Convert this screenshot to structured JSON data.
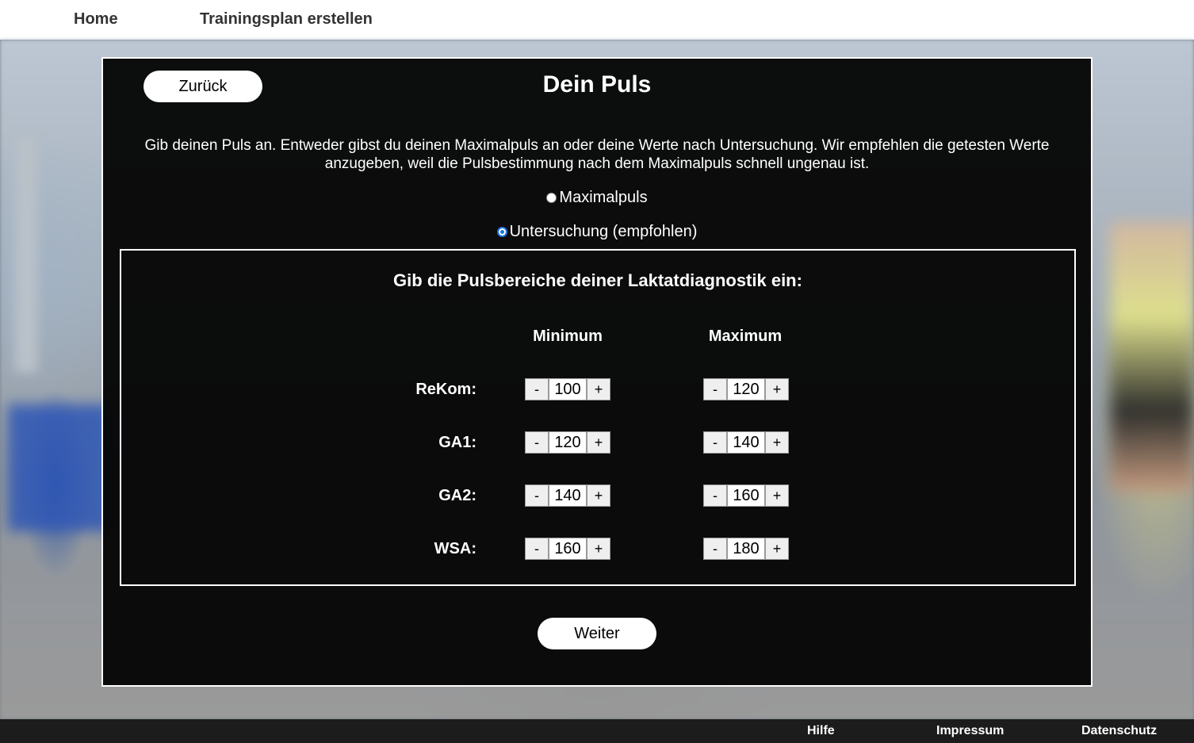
{
  "nav": {
    "home": "Home",
    "create_plan": "Trainingsplan erstellen"
  },
  "panel": {
    "back_label": "Zurück",
    "title": "Dein Puls",
    "intro": "Gib deinen Puls an. Entweder gibst du deinen Maximalpuls an oder deine Werte nach Untersuchung. Wir empfehlen die getesten Werte anzugeben, weil die Pulsbestimmung nach dem Maximalpuls schnell ungenau ist.",
    "options": [
      {
        "label": "Maximalpuls",
        "checked": false
      },
      {
        "label": "Untersuchung (empfohlen)",
        "checked": true
      }
    ],
    "next_label": "Weiter"
  },
  "zones": {
    "title": "Gib die Pulsbereiche deiner Laktatdiagnostik ein:",
    "col_min": "Minimum",
    "col_max": "Maximum",
    "minus": "-",
    "plus": "+",
    "rows": [
      {
        "label": "ReKom:",
        "min": "100",
        "max": "120"
      },
      {
        "label": "GA1:",
        "min": "120",
        "max": "140"
      },
      {
        "label": "GA2:",
        "min": "140",
        "max": "160"
      },
      {
        "label": "WSA:",
        "min": "160",
        "max": "180"
      }
    ]
  },
  "footer": {
    "help": "Hilfe",
    "imprint": "Impressum",
    "privacy": "Datenschutz"
  },
  "colors": {
    "panel_bg": "#050505",
    "accent_radio": "#1a73e8",
    "footer_bg": "#1c1c1c"
  }
}
